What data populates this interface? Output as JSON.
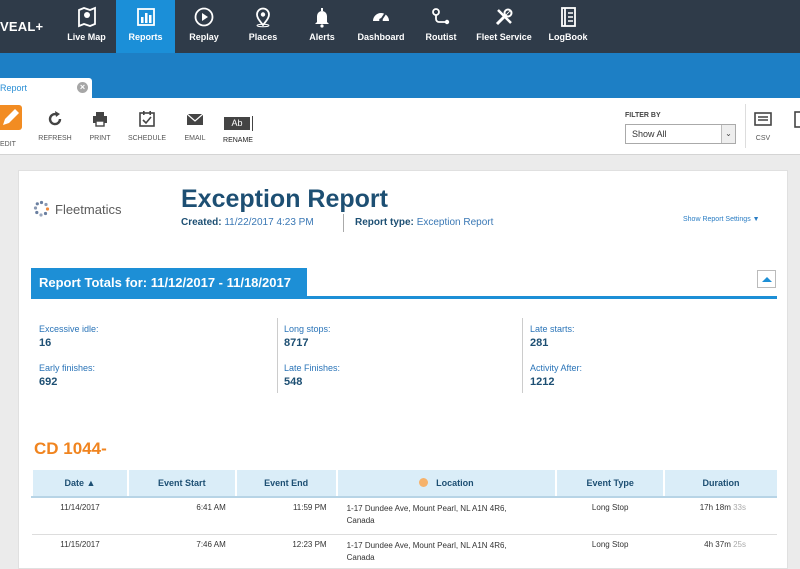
{
  "brand": "VEAL+",
  "nav": [
    {
      "label": "Live Map",
      "icon": "map-pin-icon"
    },
    {
      "label": "Reports",
      "icon": "bar-chart-icon",
      "active": true
    },
    {
      "label": "Replay",
      "icon": "play-circle-icon"
    },
    {
      "label": "Places",
      "icon": "location-pin-icon"
    },
    {
      "label": "Alerts",
      "icon": "bell-icon"
    },
    {
      "label": "Dashboard",
      "icon": "speedometer-icon"
    },
    {
      "label": "Routist",
      "icon": "route-icon"
    },
    {
      "label": "Fleet Service",
      "icon": "wrench-icon"
    },
    {
      "label": "LogBook",
      "icon": "logbook-icon"
    }
  ],
  "tab": {
    "label": "Report",
    "close": "×"
  },
  "toolbar": {
    "edit": "EDIT",
    "refresh": "REFRESH",
    "print": "PRINT",
    "schedule": "SCHEDULE",
    "email": "EMAIL",
    "rename": "RENAME",
    "rename_glyph": "Ab",
    "filter_label": "FILTER BY",
    "filter_value": "Show All",
    "csv": "CSV"
  },
  "report": {
    "logo": "Fleetmatics",
    "title": "Exception Report",
    "created_label": "Created:",
    "created_value": "11/22/2017 4:23 PM",
    "type_label": "Report type:",
    "type_value": "Exception Report",
    "settings_link": "Show Report Settings ▼",
    "totals_title": "Report Totals for:  11/12/2017 - 11/18/2017",
    "stats": [
      {
        "label": "Excessive idle:",
        "value": "16"
      },
      {
        "label": "Early finishes:",
        "value": "692"
      },
      {
        "label": "Long stops:",
        "value": "8717"
      },
      {
        "label": "Late Finishes:",
        "value": "548"
      },
      {
        "label": "Late starts:",
        "value": "281"
      },
      {
        "label": "Activity After:",
        "value": "1212"
      }
    ],
    "vehicle": "CD 1044-"
  },
  "table": {
    "headers": [
      "Date ▲",
      "Event Start",
      "Event End",
      "Location",
      "Event Type",
      "Duration"
    ],
    "rows": [
      {
        "date": "11/14/2017",
        "start": "6:41 AM",
        "end": "11:59 PM",
        "location_1": "1-17 Dundee Ave, Mount Pearl, NL A1N 4R6,",
        "location_2": "Canada",
        "type": "Long Stop",
        "duration": "17h 18m",
        "seconds": "33s"
      },
      {
        "date": "11/15/2017",
        "start": "7:46 AM",
        "end": "12:23 PM",
        "location_1": "1-17 Dundee Ave, Mount Pearl, NL A1N 4R6,",
        "location_2": "Canada",
        "type": "Long Stop",
        "duration": "4h 37m",
        "seconds": "25s"
      }
    ]
  },
  "colors": {
    "nav_bg": "#2f3b49",
    "accent": "#1d8fd6",
    "vehicle": "#f0841f"
  }
}
